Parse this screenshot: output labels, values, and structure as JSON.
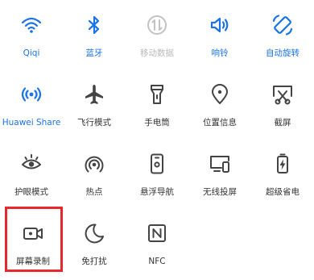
{
  "tiles": [
    {
      "label": "Qiqi",
      "icon": "wifi-icon",
      "state": "active"
    },
    {
      "label": "蓝牙",
      "icon": "bluetooth-icon",
      "state": "active"
    },
    {
      "label": "移动数据",
      "icon": "mobile-data-icon",
      "state": "disabled"
    },
    {
      "label": "响铃",
      "icon": "sound-icon",
      "state": "active"
    },
    {
      "label": "自动旋转",
      "icon": "auto-rotate-icon",
      "state": "active"
    },
    {
      "label": "Huawei Share",
      "icon": "huawei-share-icon",
      "state": "active"
    },
    {
      "label": "飞行模式",
      "icon": "airplane-icon",
      "state": "off"
    },
    {
      "label": "手电筒",
      "icon": "flashlight-icon",
      "state": "off"
    },
    {
      "label": "位置信息",
      "icon": "location-icon",
      "state": "off"
    },
    {
      "label": "截屏",
      "icon": "screenshot-icon",
      "state": "off"
    },
    {
      "label": "护眼模式",
      "icon": "eye-comfort-icon",
      "state": "off"
    },
    {
      "label": "热点",
      "icon": "hotspot-icon",
      "state": "off"
    },
    {
      "label": "悬浮导航",
      "icon": "floating-nav-icon",
      "state": "off"
    },
    {
      "label": "无线投屏",
      "icon": "wireless-projection-icon",
      "state": "off"
    },
    {
      "label": "超级省电",
      "icon": "power-saving-icon",
      "state": "off"
    },
    {
      "label": "屏幕录制",
      "icon": "screen-recorder-icon",
      "state": "off"
    },
    {
      "label": "免打扰",
      "icon": "do-not-disturb-icon",
      "state": "off"
    },
    {
      "label": "NFC",
      "icon": "nfc-icon",
      "state": "off"
    }
  ],
  "highlight": {
    "target": "屏幕录制",
    "color": "#e8282b"
  },
  "colors": {
    "active": "#1a73e8",
    "default": "#444444",
    "disabled": "#b9b9b9"
  }
}
